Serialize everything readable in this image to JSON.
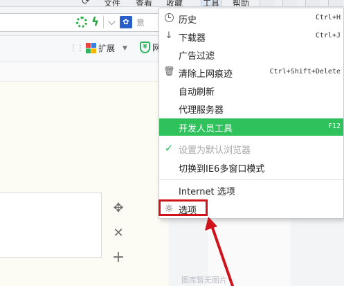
{
  "menubar": {
    "items": [
      "文件",
      "查看",
      "收藏",
      "工具",
      "帮助"
    ]
  },
  "addressbar": {
    "search_hint": "意"
  },
  "toolbar": {
    "extensions_label": "扩展",
    "shield_label": "网"
  },
  "tools_menu": {
    "items": [
      {
        "label": "历史",
        "shortcut": "Ctrl+H",
        "icon": "clock-icon"
      },
      {
        "label": "下载器",
        "shortcut": "Ctrl+J",
        "icon": "download-arrow-icon"
      },
      {
        "label": "广告过滤",
        "shortcut": "",
        "icon": ""
      },
      {
        "label": "清除上网痕迹",
        "shortcut": "Ctrl+Shift+Delete",
        "icon": "trash-icon"
      },
      {
        "label": "自动刷新",
        "shortcut": "",
        "icon": ""
      },
      {
        "label": "代理服务器",
        "shortcut": "",
        "icon": ""
      },
      {
        "label": "开发人员工具",
        "shortcut": "F12",
        "icon": "",
        "highlighted": true
      },
      {
        "label": "设置为默认浏览器",
        "shortcut": "",
        "icon": "checkmark-icon",
        "disabled": true
      },
      {
        "label": "切换到IE6多窗口模式",
        "shortcut": "",
        "icon": ""
      },
      {
        "label": "Internet 选项",
        "shortcut": "",
        "icon": ""
      },
      {
        "label": "选项",
        "shortcut": "",
        "icon": "gear-icon"
      }
    ]
  },
  "content": {
    "empty_text": "图库暂无图片"
  },
  "colors": {
    "highlight": "#2ec15c",
    "annotation_red": "#d0121b"
  }
}
